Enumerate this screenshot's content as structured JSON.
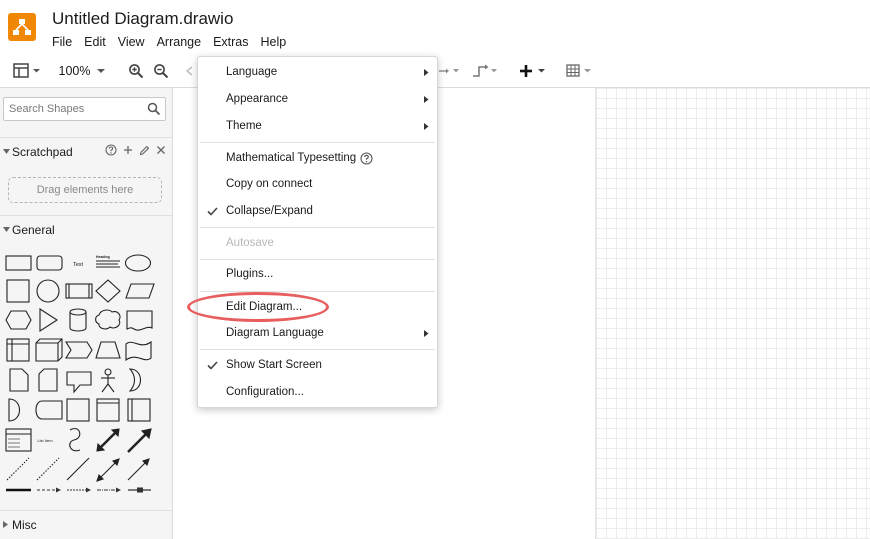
{
  "app": {
    "title": "Untitled Diagram.drawio",
    "brand_color": "#f08705",
    "logo_icon": "drawio-logo-icon"
  },
  "menubar": [
    {
      "label": "File"
    },
    {
      "label": "Edit"
    },
    {
      "label": "View"
    },
    {
      "label": "Arrange"
    },
    {
      "label": "Extras"
    },
    {
      "label": "Help"
    }
  ],
  "toolbar": {
    "zoom": "100%"
  },
  "sidebar": {
    "search_placeholder": "Search Shapes",
    "sections": [
      {
        "label": "Scratchpad",
        "drop_hint": "Drag elements here"
      },
      {
        "label": "General"
      },
      {
        "label": "Misc"
      }
    ],
    "shape_text_label": "Text",
    "shape_heading_label": "Heading",
    "shape_list_label": "List Item"
  },
  "extras_menu": {
    "items": [
      {
        "label": "Language",
        "submenu": true
      },
      {
        "label": "Appearance",
        "submenu": true
      },
      {
        "label": "Theme",
        "submenu": true
      },
      {
        "label": "Mathematical Typesetting",
        "help_icon": true
      },
      {
        "label": "Copy on connect"
      },
      {
        "label": "Collapse/Expand",
        "checked": true
      },
      {
        "label": "Autosave",
        "disabled": true
      },
      {
        "label": "Plugins..."
      },
      {
        "label": "Edit Diagram...",
        "highlighted": true
      },
      {
        "label": "Diagram Language",
        "submenu": true
      },
      {
        "label": "Show Start Screen",
        "checked": true
      },
      {
        "label": "Configuration..."
      }
    ],
    "highlight_color": "#e85d5d"
  }
}
